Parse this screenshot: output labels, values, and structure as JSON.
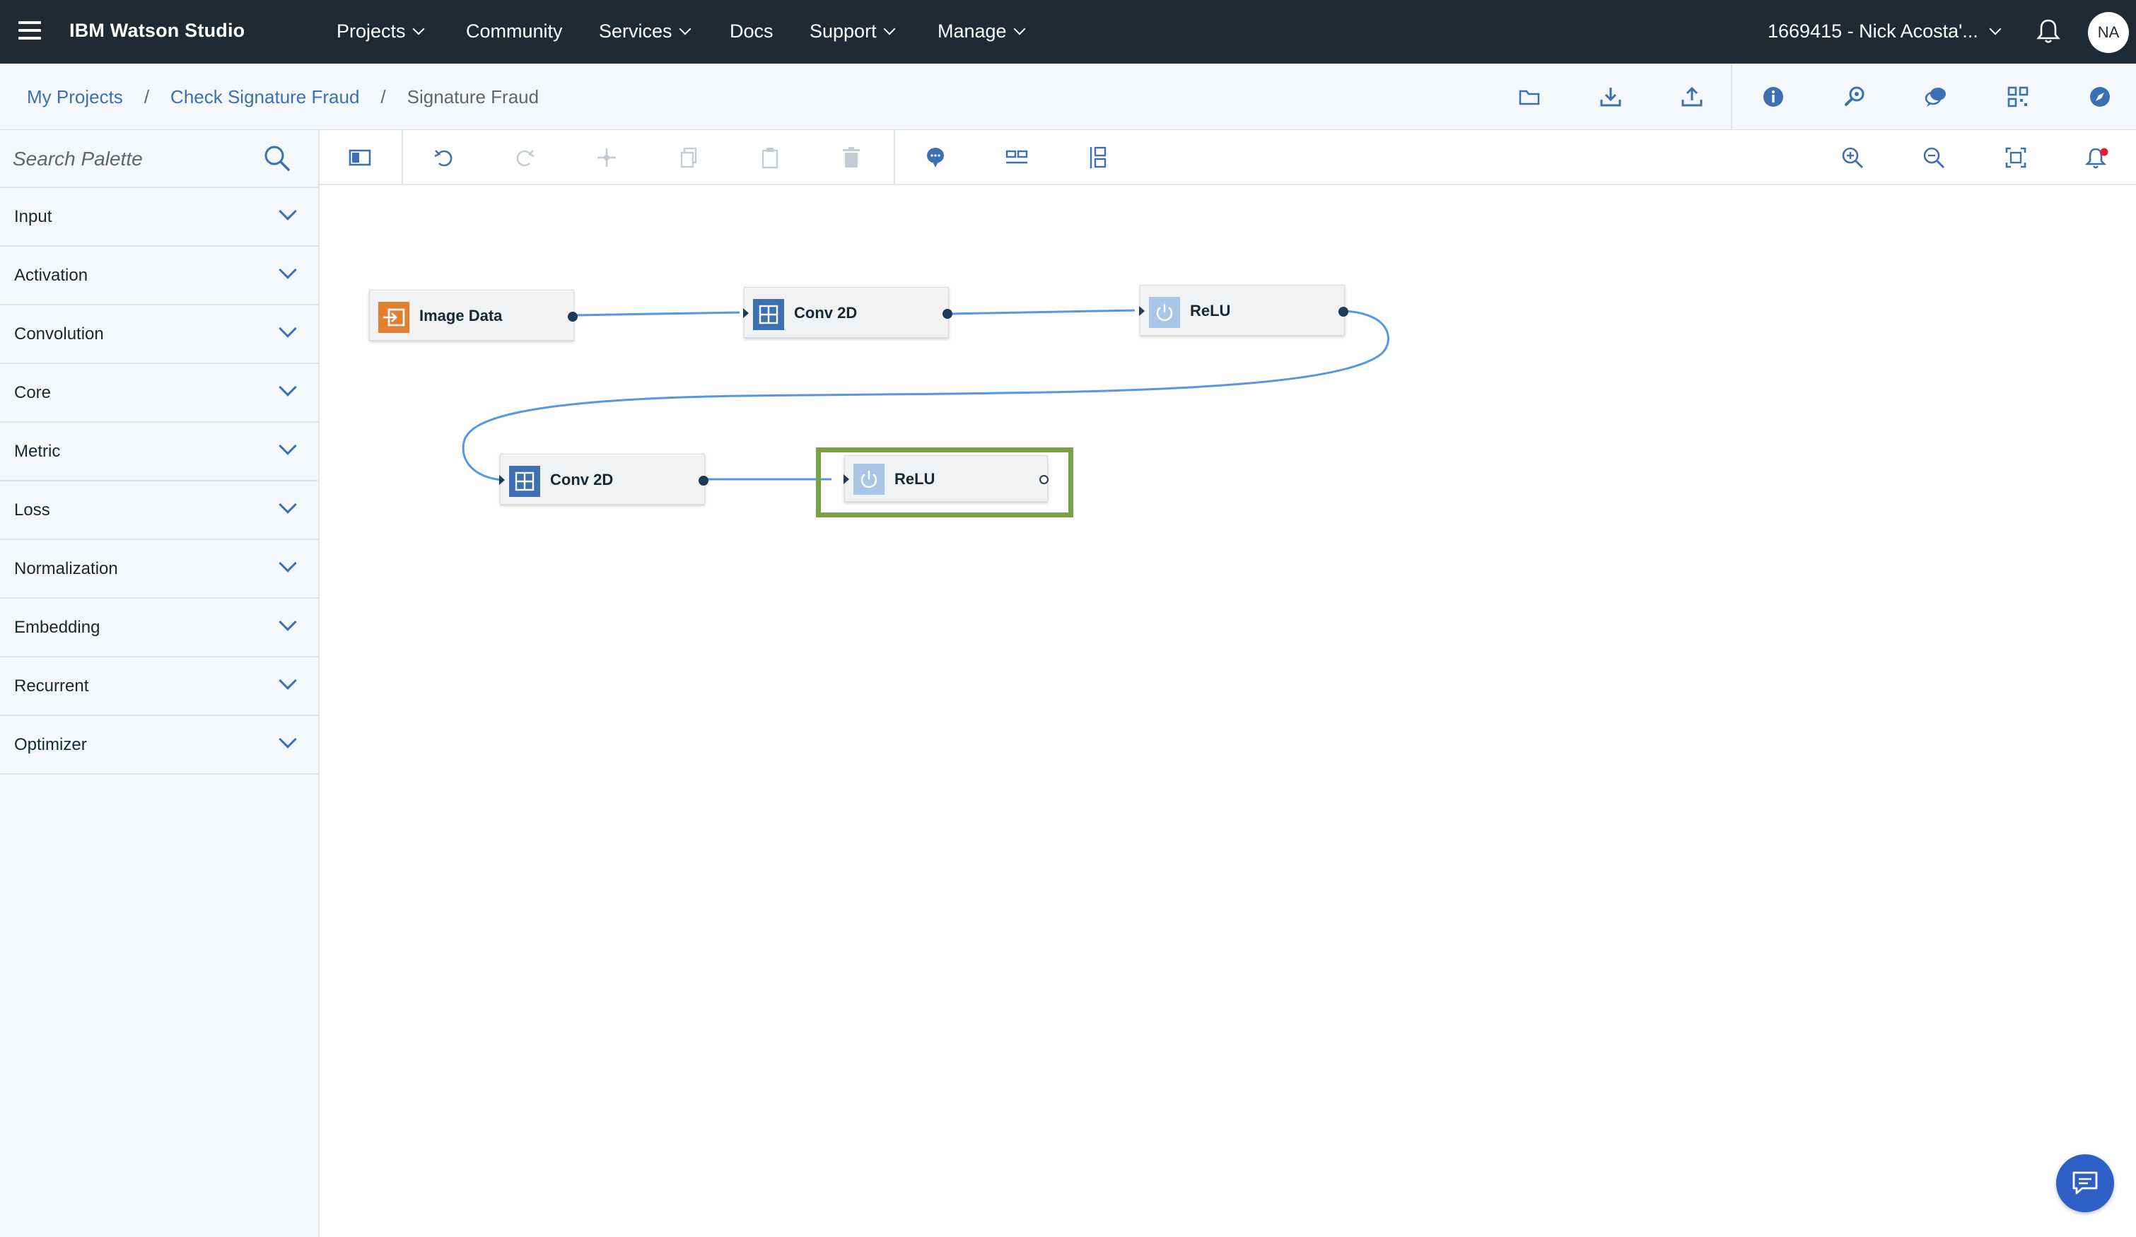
{
  "topnav": {
    "brand": "IBM Watson Studio",
    "items": [
      {
        "label": "Projects",
        "has_menu": true
      },
      {
        "label": "Community",
        "has_menu": false
      },
      {
        "label": "Services",
        "has_menu": true
      },
      {
        "label": "Docs",
        "has_menu": false
      },
      {
        "label": "Support",
        "has_menu": true
      },
      {
        "label": "Manage",
        "has_menu": true
      }
    ],
    "account": "1669415 - Nick Acosta'...",
    "avatar_initials": "NA",
    "icons": [
      "hamburger-icon",
      "bell-icon"
    ]
  },
  "breadcrumb": {
    "items": [
      "My Projects",
      "Check Signature Fraud"
    ],
    "separator": "/",
    "current": "Signature Fraud"
  },
  "toolbar_icons": [
    "folder-icon",
    "download-icon",
    "upload-icon",
    "info-icon",
    "wrench-icon",
    "chat-bubbles-icon",
    "grid-icon",
    "compass-icon"
  ],
  "palette": {
    "search_placeholder": "Search Palette",
    "categories": [
      "Input",
      "Activation",
      "Convolution",
      "Core",
      "Metric",
      "Loss",
      "Normalization",
      "Embedding",
      "Recurrent",
      "Optimizer"
    ]
  },
  "canvas_toolbar_icons": [
    "toggle-palette-icon",
    "undo-icon",
    "redo-icon",
    "move-icon",
    "copy-icon",
    "paste-icon",
    "delete-icon",
    "comment-icon",
    "arrange-horizontal-icon",
    "arrange-vertical-icon",
    "zoom-in-icon",
    "zoom-out-icon",
    "fit-to-screen-icon",
    "notifications-icon"
  ],
  "canvas": {
    "nodes": [
      {
        "label": "Image Data",
        "icon": "input-icon",
        "color": "#e2802f"
      },
      {
        "label": "Conv 2D",
        "icon": "conv-grid-icon",
        "color": "#3d70b2"
      },
      {
        "label": "ReLU",
        "icon": "power-icon",
        "color": "#a9c6e6"
      },
      {
        "label": "Conv 2D",
        "icon": "conv-grid-icon",
        "color": "#3d70b2"
      },
      {
        "label": "ReLU",
        "icon": "power-icon",
        "color": "#a9c6e6",
        "selected": true
      }
    ],
    "link_color": "#5596e6",
    "selection_color": "#79a244"
  },
  "chat_button": {
    "icon": "chat-icon",
    "color": "#2d5fc7"
  }
}
